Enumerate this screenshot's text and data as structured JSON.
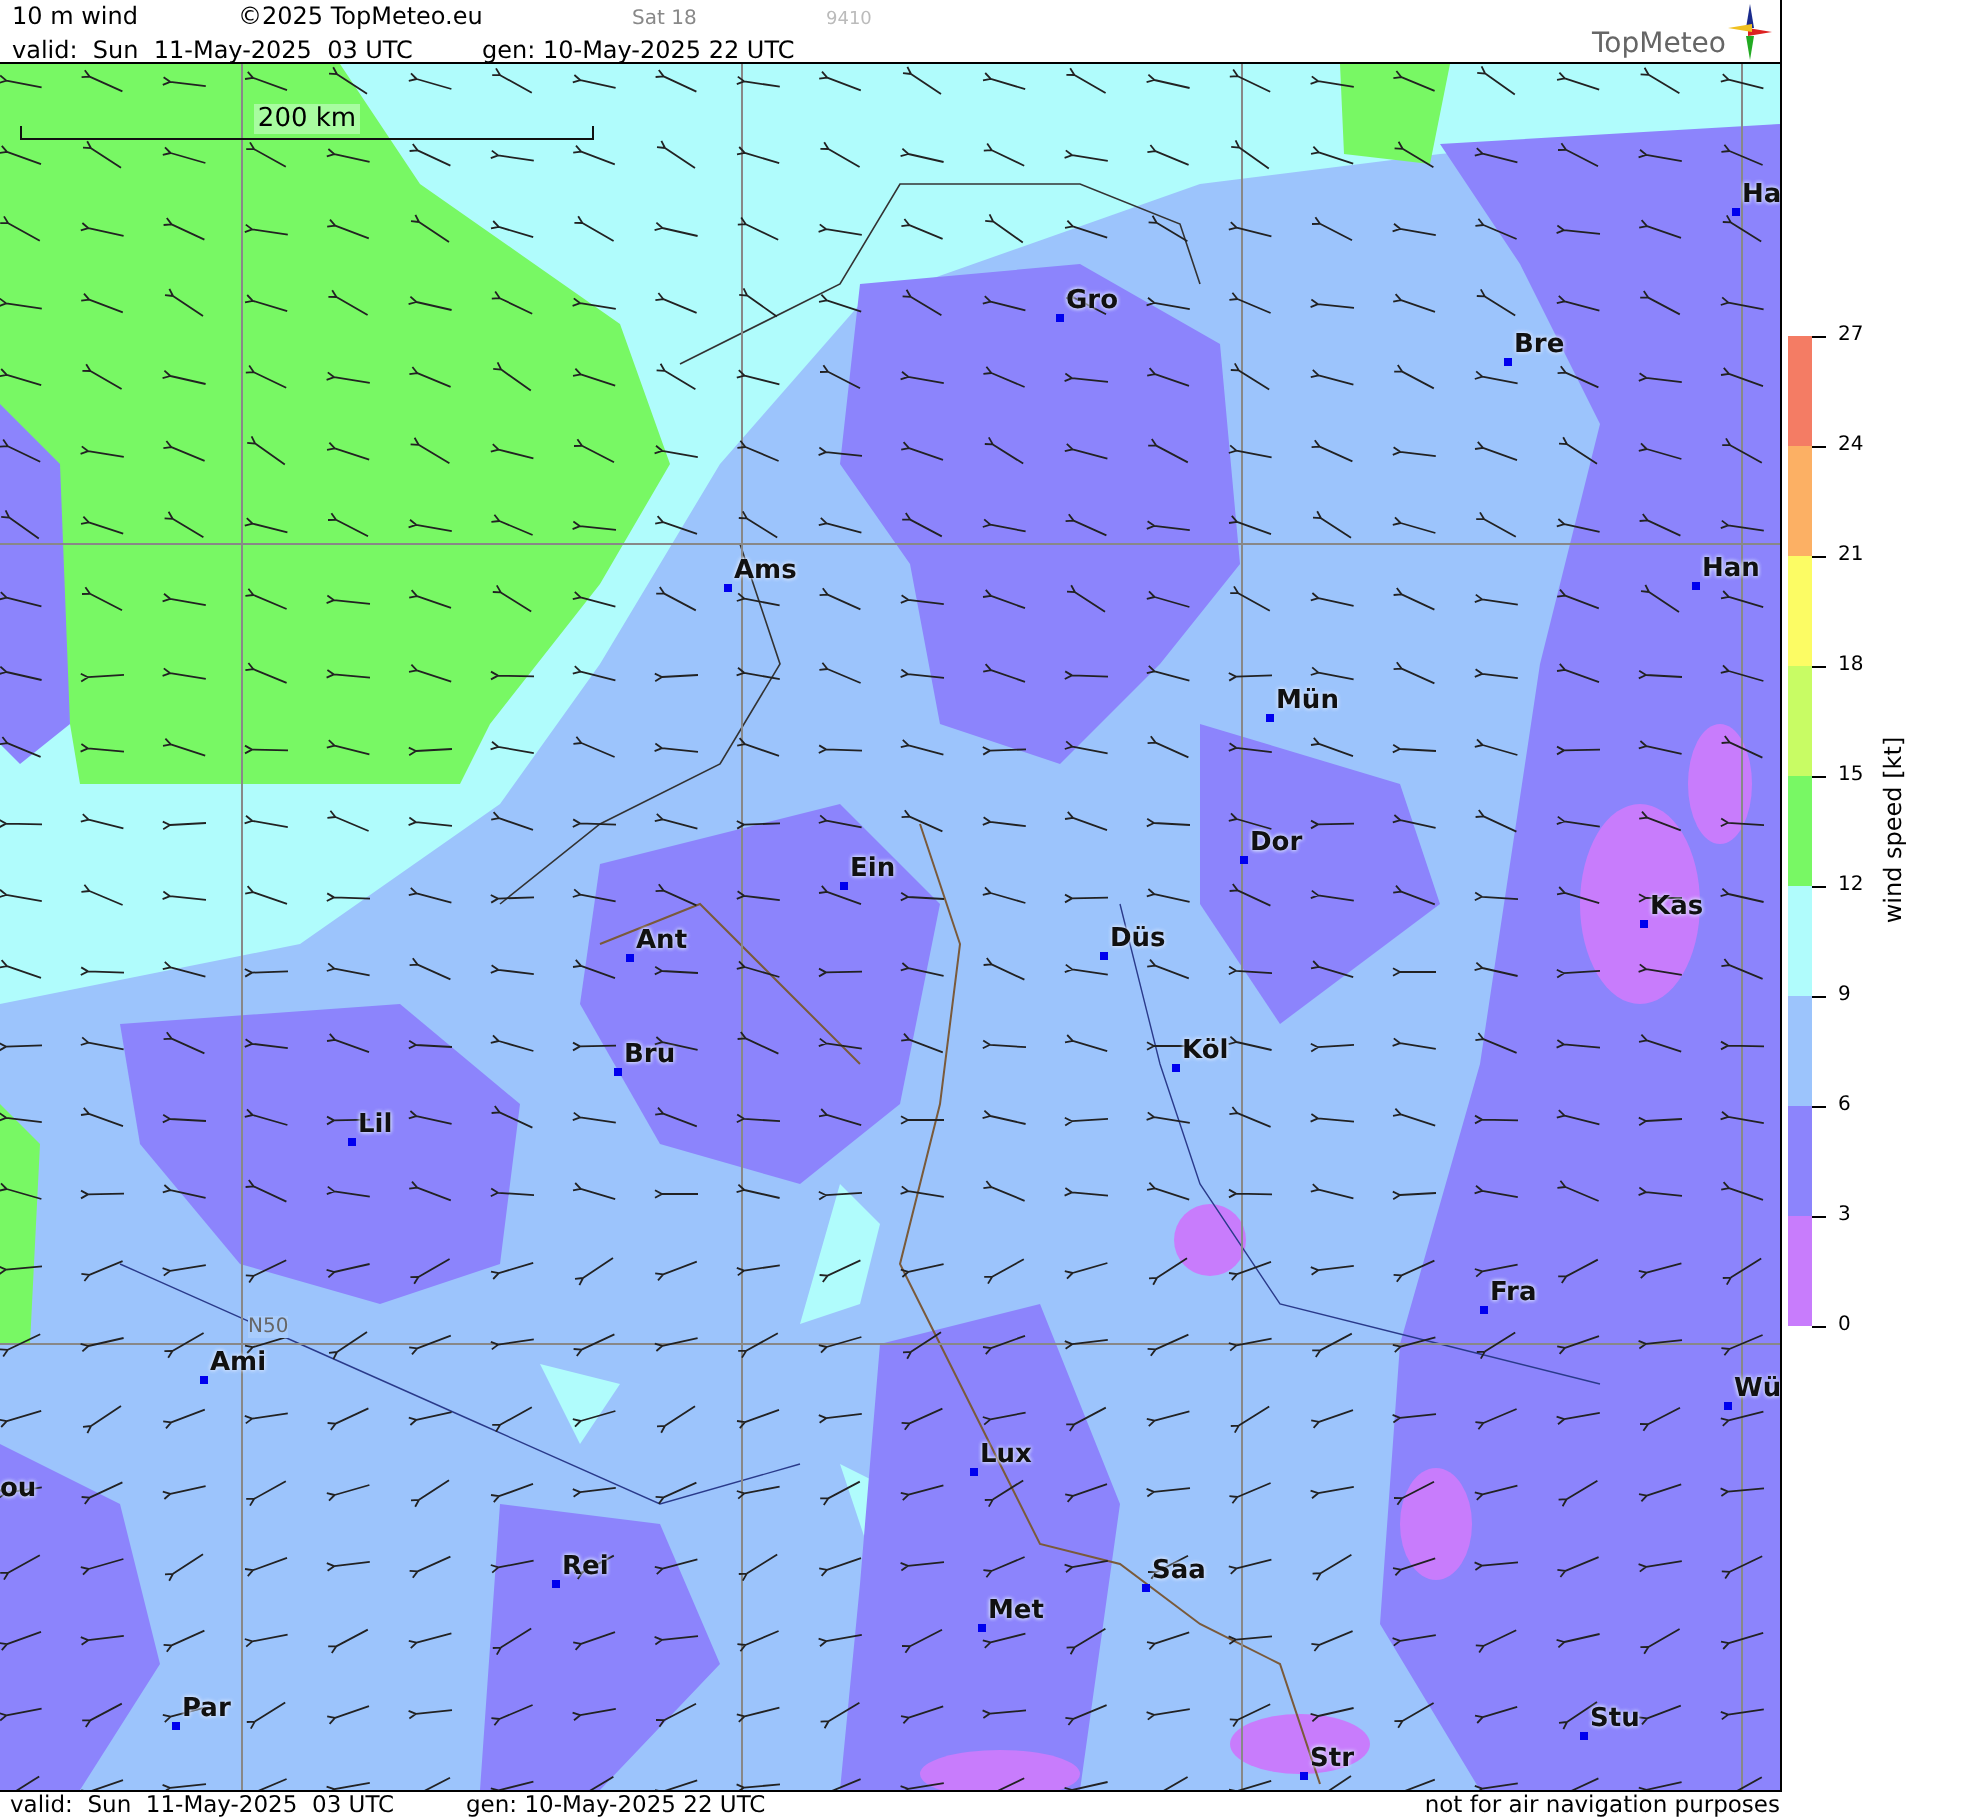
{
  "header": {
    "title": "10 m wind",
    "copyright": "©2025 TopMeteo.eu",
    "satellite": "Sat 18",
    "code": "9410",
    "valid": "valid:  Sun  11-May-2025  03 UTC",
    "generated": "gen: 10-May-2025 22 UTC",
    "logo": "TopMeteo"
  },
  "map": {
    "scale": "200 km",
    "latitude_label": "N50",
    "cities": [
      {
        "name": "Ha"
      },
      {
        "name": "Gro"
      },
      {
        "name": "Bre"
      },
      {
        "name": "Ams"
      },
      {
        "name": "Han"
      },
      {
        "name": "Mün"
      },
      {
        "name": "Dor"
      },
      {
        "name": "Ein"
      },
      {
        "name": "Kas"
      },
      {
        "name": "Düs"
      },
      {
        "name": "Ant"
      },
      {
        "name": "Bru"
      },
      {
        "name": "Köl"
      },
      {
        "name": "Lil"
      },
      {
        "name": "Fra"
      },
      {
        "name": "Ami"
      },
      {
        "name": "Wü"
      },
      {
        "name": "Lux"
      },
      {
        "name": "ou"
      },
      {
        "name": "Rei"
      },
      {
        "name": "Saa"
      },
      {
        "name": "Met"
      },
      {
        "name": "Par"
      },
      {
        "name": "Stu"
      },
      {
        "name": "Str"
      }
    ]
  },
  "legend": {
    "title": "wind speed [kt]",
    "ticks": [
      "27",
      "24",
      "21",
      "18",
      "15",
      "12",
      "9",
      "6",
      "3",
      "0"
    ],
    "bands": [
      {
        "color": "#f47c64"
      },
      {
        "color": "#fcb064"
      },
      {
        "color": "#fcfc64"
      },
      {
        "color": "#c8fc64"
      },
      {
        "color": "#78f864"
      },
      {
        "color": "#b0fcfc"
      },
      {
        "color": "#9cc4fc"
      },
      {
        "color": "#8c84fc"
      },
      {
        "color": "#c87cfc"
      }
    ]
  },
  "footer": {
    "valid": "valid:  Sun  11-May-2025  03 UTC",
    "generated": "gen: 10-May-2025 22 UTC",
    "disclaimer": "not for air navigation purposes"
  }
}
